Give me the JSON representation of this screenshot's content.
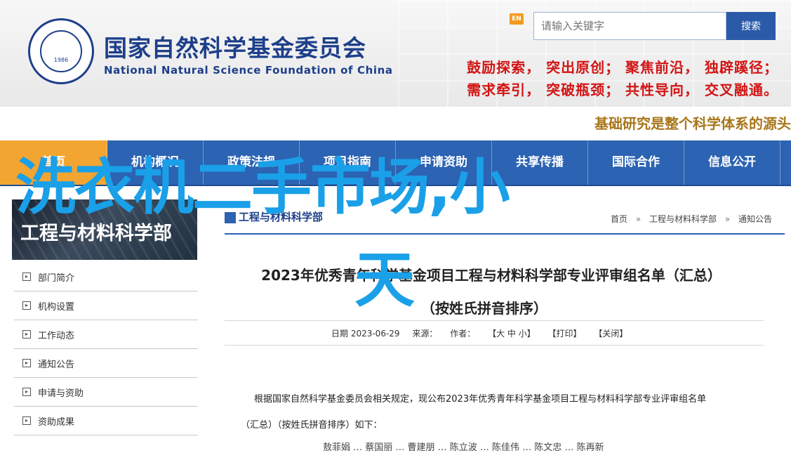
{
  "header": {
    "org_name_cn": "国家自然科学基金委员会",
    "org_name_en": "National Natural Science Foundation of China",
    "seal_year": "1986",
    "en_badge": "EN",
    "search_placeholder": "请输入关键字",
    "search_button": "搜索",
    "motto_line1": "鼓励探索， 突出原创； 聚焦前沿， 独辟蹊径；",
    "motto_line2": "需求牵引， 突破瓶颈； 共性导向， 交叉融通。",
    "banner": "基础研究是整个科学体系的源头"
  },
  "nav": {
    "items": [
      "首页",
      "机构概况",
      "政策法规",
      "项目指南",
      "申请资助",
      "共享传播",
      "国际合作",
      "信息公开"
    ]
  },
  "sidebar": {
    "banner_title": "工程与材料科学部",
    "items": [
      "部门简介",
      "机构设置",
      "工作动态",
      "通知公告",
      "申请与资助",
      "资助成果"
    ]
  },
  "content": {
    "section_title": "工程与材料科学部",
    "breadcrumb": [
      "首页",
      "工程与材料科学部",
      "通知公告"
    ],
    "breadcrumb_sep": "»",
    "title": "2023年优秀青年科学基金项目工程与材料科学部专业评审组名单（汇总）",
    "subtitle": "（按姓氏拼音排序）",
    "meta": {
      "date": "日期 2023-06-29",
      "source": "来源：",
      "author": "作者：",
      "font_size": "【大 中 小】",
      "print": "【打印】",
      "close": "【关闭】"
    },
    "para1": "根据国家自然科学基金委员会相关规定，现公布2023年优秀青年科学基金项目工程与材料科学部专业评审组名单",
    "para2": "（汇总）（按姓氏拼音排序）如下：",
    "para3": "敖菲娟 … 蔡国丽 … 曹建朋 … 陈立波 … 陈佳伟 … 陈文忠 … 陈再新"
  },
  "overlay": {
    "line1": "洗衣机二手市场,小",
    "line2": "天"
  },
  "colors": {
    "brand_blue": "#1d3f8a",
    "nav_blue": "#2c63b2",
    "nav_active": "#f3a531",
    "motto_red": "#d21414",
    "overlay_blue": "#1aa0e8"
  }
}
